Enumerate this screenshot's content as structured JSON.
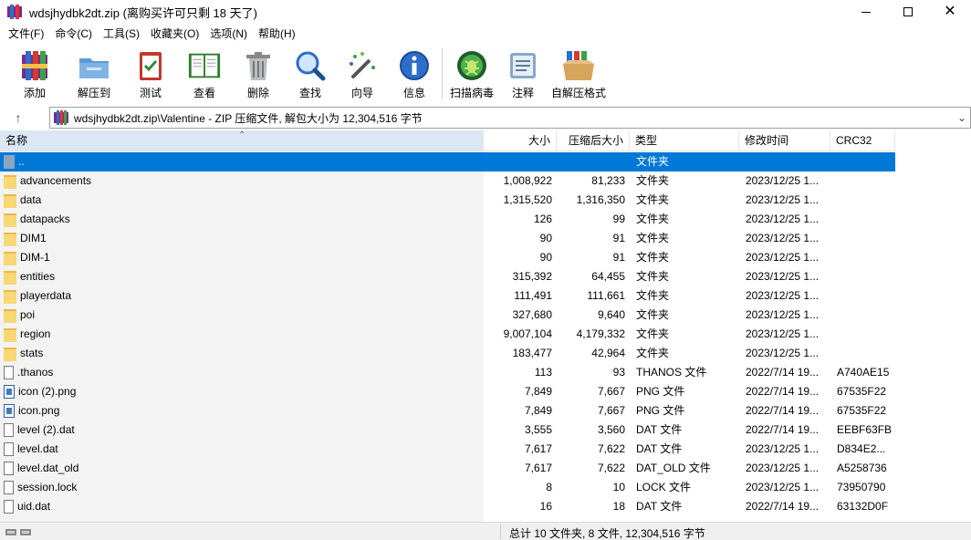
{
  "window": {
    "title": "wdsjhydbk2dt.zip (离购买许可只剩 18 天了)"
  },
  "menu": [
    "文件(F)",
    "命令(C)",
    "工具(S)",
    "收藏夹(O)",
    "选项(N)",
    "帮助(H)"
  ],
  "toolbar": [
    {
      "label": "添加",
      "icon": "archive-add-icon"
    },
    {
      "label": "解压到",
      "icon": "extract-folder-icon"
    },
    {
      "label": "测试",
      "icon": "test-clipboard-icon"
    },
    {
      "label": "查看",
      "icon": "view-book-icon"
    },
    {
      "label": "删除",
      "icon": "trash-icon"
    },
    {
      "label": "查找",
      "icon": "magnifier-icon"
    },
    {
      "label": "向导",
      "icon": "wizard-wand-icon"
    },
    {
      "label": "信息",
      "icon": "info-icon"
    },
    {
      "label": "扫描病毒",
      "icon": "virus-scan-icon"
    },
    {
      "label": "注释",
      "icon": "comment-icon"
    },
    {
      "label": "自解压格式",
      "icon": "sfx-box-icon"
    }
  ],
  "address": {
    "path": "wdsjhydbk2dt.zip\\Valentine - ZIP 压缩文件, 解包大小为 12,304,516 字节"
  },
  "columns": {
    "name": "名称",
    "size": "大小",
    "packed": "压缩后大小",
    "type": "类型",
    "modified": "修改时间",
    "crc": "CRC32"
  },
  "files": [
    {
      "name": "..",
      "size": "",
      "packed": "",
      "type": "文件夹",
      "modified": "",
      "crc": "",
      "kind": "up"
    },
    {
      "name": "advancements",
      "size": "1,008,922",
      "packed": "81,233",
      "type": "文件夹",
      "modified": "2023/12/25 1...",
      "crc": "",
      "kind": "folder"
    },
    {
      "name": "data",
      "size": "1,315,520",
      "packed": "1,316,350",
      "type": "文件夹",
      "modified": "2023/12/25 1...",
      "crc": "",
      "kind": "folder"
    },
    {
      "name": "datapacks",
      "size": "126",
      "packed": "99",
      "type": "文件夹",
      "modified": "2023/12/25 1...",
      "crc": "",
      "kind": "folder"
    },
    {
      "name": "DIM1",
      "size": "90",
      "packed": "91",
      "type": "文件夹",
      "modified": "2023/12/25 1...",
      "crc": "",
      "kind": "folder"
    },
    {
      "name": "DIM-1",
      "size": "90",
      "packed": "91",
      "type": "文件夹",
      "modified": "2023/12/25 1...",
      "crc": "",
      "kind": "folder"
    },
    {
      "name": "entities",
      "size": "315,392",
      "packed": "64,455",
      "type": "文件夹",
      "modified": "2023/12/25 1...",
      "crc": "",
      "kind": "folder"
    },
    {
      "name": "playerdata",
      "size": "111,491",
      "packed": "111,661",
      "type": "文件夹",
      "modified": "2023/12/25 1...",
      "crc": "",
      "kind": "folder"
    },
    {
      "name": "poi",
      "size": "327,680",
      "packed": "9,640",
      "type": "文件夹",
      "modified": "2023/12/25 1...",
      "crc": "",
      "kind": "folder"
    },
    {
      "name": "region",
      "size": "9,007,104",
      "packed": "4,179,332",
      "type": "文件夹",
      "modified": "2023/12/25 1...",
      "crc": "",
      "kind": "folder"
    },
    {
      "name": "stats",
      "size": "183,477",
      "packed": "42,964",
      "type": "文件夹",
      "modified": "2023/12/25 1...",
      "crc": "",
      "kind": "folder"
    },
    {
      "name": ".thanos",
      "size": "113",
      "packed": "93",
      "type": "THANOS 文件",
      "modified": "2022/7/14 19...",
      "crc": "A740AE15",
      "kind": "file"
    },
    {
      "name": "icon (2).png",
      "size": "7,849",
      "packed": "7,667",
      "type": "PNG 文件",
      "modified": "2022/7/14 19...",
      "crc": "67535F22",
      "kind": "png"
    },
    {
      "name": "icon.png",
      "size": "7,849",
      "packed": "7,667",
      "type": "PNG 文件",
      "modified": "2022/7/14 19...",
      "crc": "67535F22",
      "kind": "png"
    },
    {
      "name": "level (2).dat",
      "size": "3,555",
      "packed": "3,560",
      "type": "DAT 文件",
      "modified": "2022/7/14 19...",
      "crc": "EEBF63FB",
      "kind": "file"
    },
    {
      "name": "level.dat",
      "size": "7,617",
      "packed": "7,622",
      "type": "DAT 文件",
      "modified": "2023/12/25 1...",
      "crc": "D834E2...",
      "kind": "file"
    },
    {
      "name": "level.dat_old",
      "size": "7,617",
      "packed": "7,622",
      "type": "DAT_OLD 文件",
      "modified": "2023/12/25 1...",
      "crc": "A5258736",
      "kind": "file"
    },
    {
      "name": "session.lock",
      "size": "8",
      "packed": "10",
      "type": "LOCK 文件",
      "modified": "2023/12/25 1...",
      "crc": "73950790",
      "kind": "file"
    },
    {
      "name": "uid.dat",
      "size": "16",
      "packed": "18",
      "type": "DAT 文件",
      "modified": "2022/7/14 19...",
      "crc": "63132D0F",
      "kind": "file"
    }
  ],
  "status": {
    "summary": "总计 10 文件夹, 8 文件, 12,304,516 字节"
  },
  "colors": {
    "selection": "#0078d7",
    "folder": "#f8d775"
  }
}
